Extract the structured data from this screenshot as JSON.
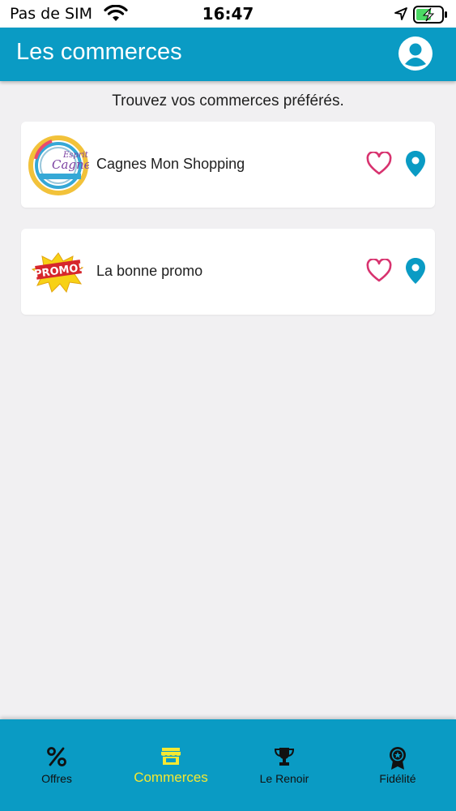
{
  "status_bar": {
    "carrier": "Pas de SIM",
    "time": "16:47"
  },
  "header": {
    "title": "Les commerces"
  },
  "subtitle": "Trouvez vos commerces préférés.",
  "shops": [
    {
      "name": "Cagnes Mon Shopping",
      "logo": "esprit-cagnes-logo",
      "logo_text_top": "Esprit",
      "logo_text_main": "Cagnes"
    },
    {
      "name": "La bonne promo",
      "logo": "promo-logo",
      "logo_text_main": "PROMO!"
    }
  ],
  "tabbar": {
    "tabs": [
      {
        "label": "Offres",
        "icon": "percent-icon"
      },
      {
        "label": "Commerces",
        "icon": "store-icon",
        "active": true
      },
      {
        "label": "Le Renoir",
        "icon": "trophy-icon"
      },
      {
        "label": "Fidélité",
        "icon": "award-icon"
      }
    ]
  },
  "colors": {
    "primary": "#0a9bc4",
    "heart": "#d8336f",
    "pin": "#0a9bc4",
    "active_tab": "#f4e832",
    "background": "#f1f0f2"
  }
}
